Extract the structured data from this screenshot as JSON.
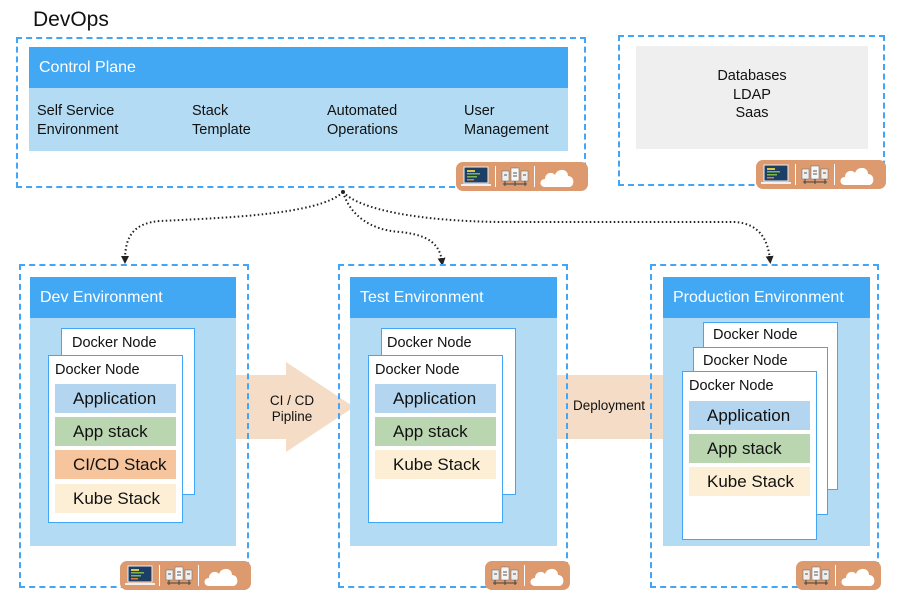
{
  "title": "DevOps",
  "control_plane": {
    "header": "Control Plane",
    "items": [
      {
        "line1": "Self Service",
        "line2": "Environment"
      },
      {
        "line1": "Stack",
        "line2": "Template"
      },
      {
        "line1": "Automated",
        "line2": "Operations"
      },
      {
        "line1": "User",
        "line2": "Management"
      }
    ]
  },
  "external_services": [
    "Databases",
    "LDAP",
    "Saas"
  ],
  "environments": {
    "dev": {
      "header": "Dev Environment",
      "node_labels": [
        "Docker Node",
        "Docker Node"
      ],
      "layers": [
        "Application",
        "App stack",
        "CI/CD Stack",
        "Kube Stack"
      ]
    },
    "test": {
      "header": "Test Environment",
      "node_labels": [
        "Docker Node",
        "Docker Node"
      ],
      "layers": [
        "Application",
        "App stack",
        "Kube Stack"
      ]
    },
    "prod": {
      "header": "Production Environment",
      "node_labels": [
        "Docker Node",
        "Docker Node",
        "Docker Node"
      ],
      "layers": [
        "Application",
        "App stack",
        "Kube Stack"
      ]
    }
  },
  "flows": {
    "cicd": {
      "line1": "CI / CD",
      "line2": "Pipline"
    },
    "deployment": "Deployment"
  },
  "toolbar_icons": [
    "laptop-code-icon",
    "server-network-icon",
    "cloud-icon"
  ],
  "colors": {
    "accent": "#42a8f4",
    "panel": "#b3dbf3",
    "toolbar": "#dc9a6e",
    "flow": "#f4dcc6"
  }
}
